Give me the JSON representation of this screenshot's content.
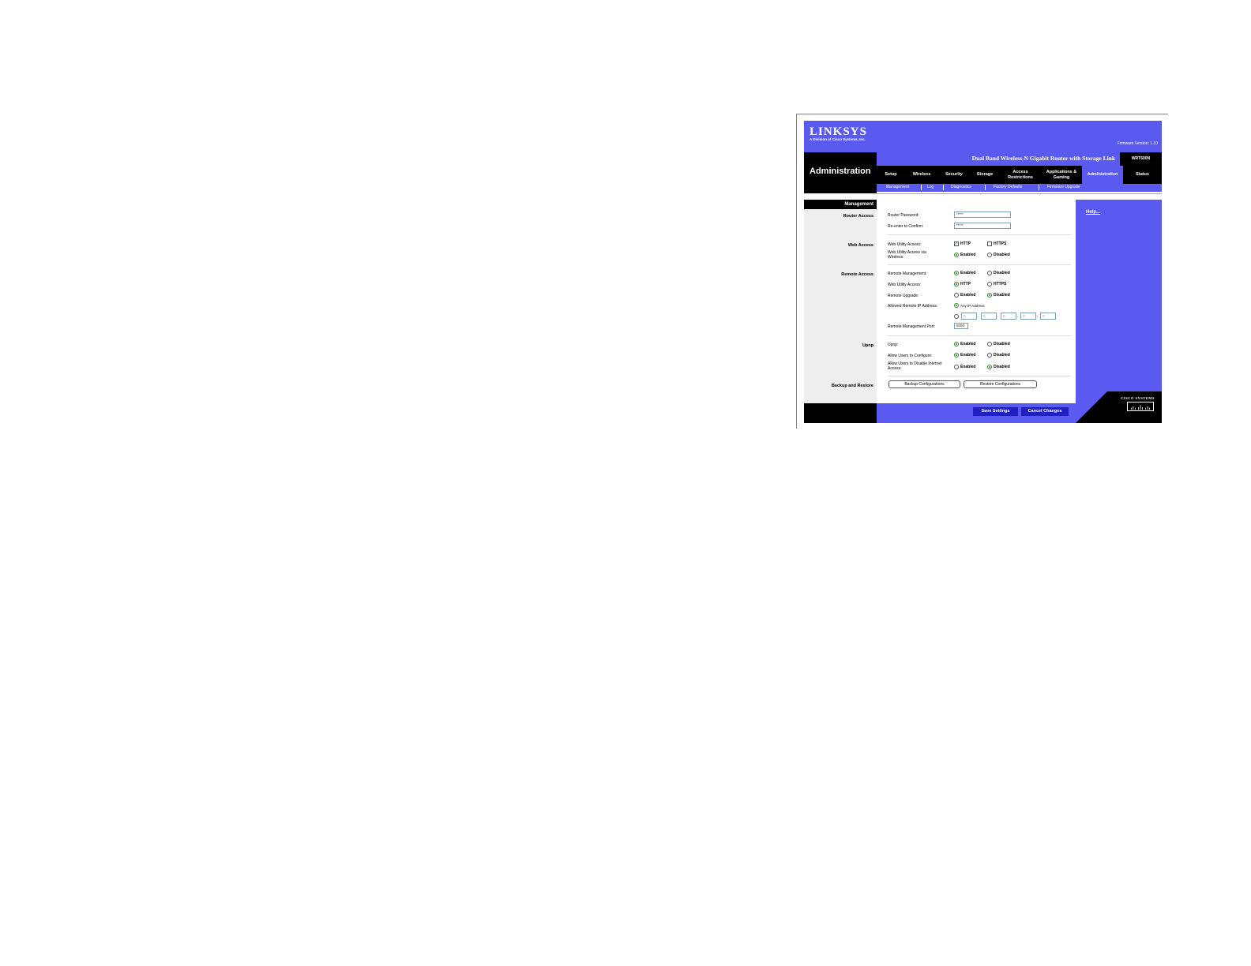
{
  "header": {
    "logo": "LINKSYS",
    "logo_sub": "A Division of Cisco Systems, Inc.",
    "firmware": "Firmware Version: 1.10",
    "product_title": "Dual Band Wireless-N Gigabit Router with Storage Link",
    "model": "WRT600N",
    "section_title": "Administration"
  },
  "tabs": [
    {
      "label": "Setup"
    },
    {
      "label": "Wireless"
    },
    {
      "label": "Security"
    },
    {
      "label": "Storage"
    },
    {
      "label": "Access Restrictions"
    },
    {
      "label": "Applications & Gaming"
    },
    {
      "label": "Administration"
    },
    {
      "label": "Status"
    }
  ],
  "subtabs": [
    {
      "label": "Management"
    },
    {
      "label": "Log"
    },
    {
      "label": "Diagnostics"
    },
    {
      "label": "Factory Defaults"
    },
    {
      "label": "Firmware Upgrade"
    }
  ],
  "sections": {
    "management": "Management",
    "router_access": "Router Access",
    "web_access": "Web Access",
    "remote_access": "Remote Access",
    "upnp": "Upnp",
    "backup": "Backup and Restore"
  },
  "router_access": {
    "password_label": "Router Password:",
    "password_value": "*****",
    "confirm_label": "Re-enter to Confirm:",
    "confirm_value": "*****"
  },
  "web_access": {
    "utility_label": "Web Utility Access:",
    "http": "HTTP",
    "https": "HTTPS",
    "wireless_label": "Web Utility Access via Wireless:",
    "enabled": "Enabled",
    "disabled": "Disabled"
  },
  "remote_access": {
    "mgmt_label": "Remote Management:",
    "utility_label": "Web Utility Access:",
    "upgrade_label": "Remote Upgrade:",
    "allowed_label": "Allowed Remote IP Address:",
    "any_ip": "Any IP Address",
    "ip_octets": [
      "0",
      "0",
      "0",
      "0",
      "0"
    ],
    "port_label": "Remote Management Port:",
    "port_value": "8080",
    "enabled": "Enabled",
    "disabled": "Disabled",
    "http": "HTTP",
    "https": "HTTPS"
  },
  "upnp": {
    "upnp_label": "Upnp:",
    "configure_label": "Allow Users to Configure:",
    "disable_label": "Allow Users to Disable Internet Access:",
    "enabled": "Enabled",
    "disabled": "Disabled"
  },
  "backup": {
    "backup_label": "Backup Configurations",
    "restore_label": "Restore Configurations"
  },
  "actions": {
    "save": "Save Settings",
    "cancel": "Cancel Changes"
  },
  "help": {
    "link": "Help..."
  },
  "cisco": {
    "brand": "CISCO SYSTEMS"
  }
}
